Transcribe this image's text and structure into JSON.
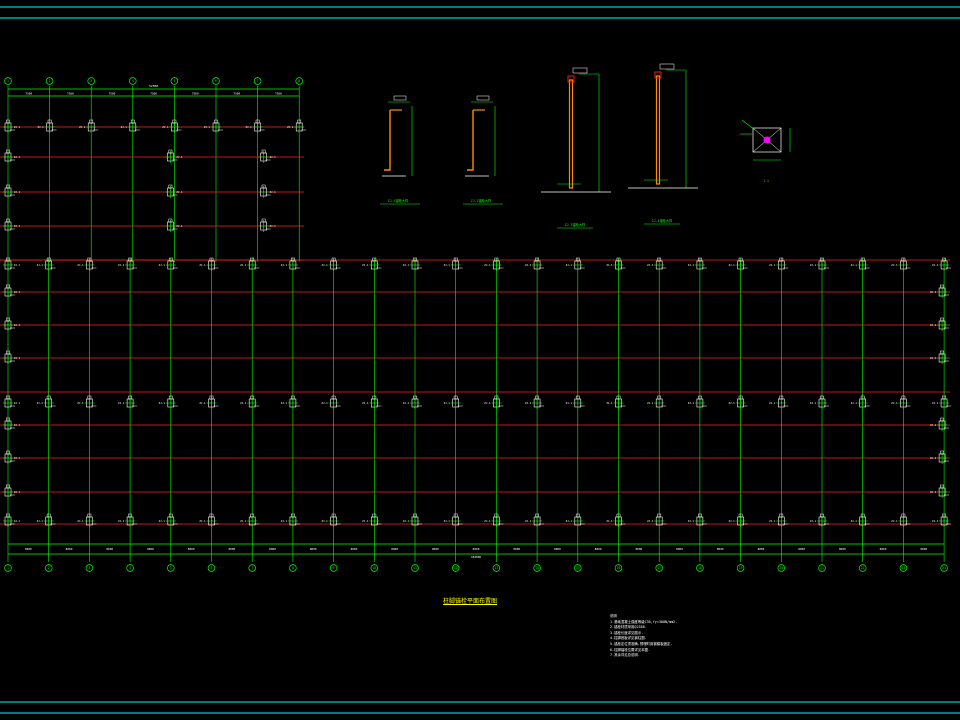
{
  "drawing": {
    "title": "柱脚锚栓平面布置图",
    "notes_title": "说明",
    "notes": [
      "1.基础混凝土强度等级C30,fy=300N/mm2.",
      "2.锚栓材质采用Q235B.",
      "3.锚栓长度详见图示.",
      "4.柱脚底板详见钢柱图.",
      "5.锚栓定位须准确,预埋时用钢模板固定.",
      "6.柱脚锚栓位置详见本图.",
      "7.其余详见总说明."
    ],
    "upper_grid_labels": [
      "1",
      "2",
      "3",
      "4",
      "5",
      "6",
      "7",
      "8"
    ],
    "lower_grid_labels": [
      "1",
      "2",
      "3",
      "4",
      "5",
      "6",
      "7",
      "8",
      "9",
      "10",
      "11",
      "12",
      "13",
      "14",
      "15",
      "16",
      "17",
      "18",
      "19",
      "20",
      "21",
      "22",
      "23",
      "24"
    ],
    "upper_span_label": "7500",
    "lower_span_label": "8000",
    "upper_total_label": "52500",
    "lower_total_label": "184000",
    "anchor_tag": "ZJ-1",
    "side_tag": "ZJ-2",
    "details": [
      {
        "caption": "ZJ-1锚栓大样"
      },
      {
        "caption": "ZJ-2锚栓大样"
      },
      {
        "caption": "ZJ-3锚栓大样"
      },
      {
        "caption": "ZJ-4锚栓大样"
      }
    ],
    "plate_caption": "1-1"
  },
  "colors": {
    "background": "#000000",
    "frame": "#00c8c8",
    "grid": "#ff2020",
    "dim": "#00ff00",
    "text": "#ffffff",
    "title": "#ffff00",
    "bolt": "#ff8c00",
    "plate_mark": "#ff00ff"
  }
}
